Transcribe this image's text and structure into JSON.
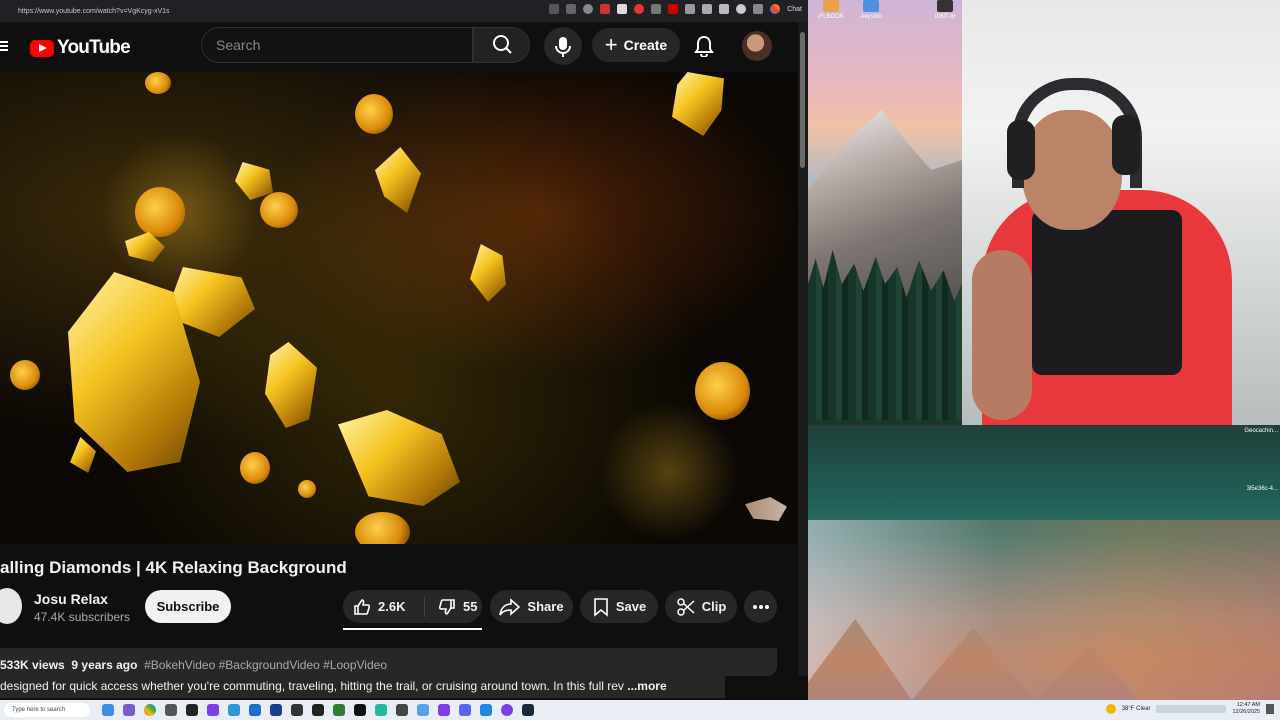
{
  "browser": {
    "url": "https://www.youtube.com/watch?v=VgKcyg-xV1s",
    "chat_label": "Chat"
  },
  "header": {
    "logo_text": "YouTube",
    "search_placeholder": "Search",
    "create_label": "Create"
  },
  "video": {
    "title": "alling Diamonds | 4K Relaxing Background",
    "channel": "Josu Relax",
    "subscribers": "47.4K subscribers",
    "subscribe_label": "Subscribe",
    "likes": "2.6K",
    "dislikes": "55",
    "share_label": "Share",
    "save_label": "Save",
    "clip_label": "Clip",
    "views": "533K views",
    "age": "9 years ago",
    "hashtags": "#BokehVideo #BackgroundVideo #LoopVideo",
    "description": "designed for quick access whether you're commuting, traveling, hitting the trail, or cruising around town. In this full rev",
    "more_label": "...more"
  },
  "desktop": {
    "icon_labels": [
      "iFLBOOK",
      "Aeysion",
      "iDNT-lo"
    ],
    "overlay_label": "Geocachin...",
    "overlay_label2": "3l5e36c-4..."
  },
  "taskbar": {
    "search_placeholder": "Type here to search",
    "weather": "38°F Clear",
    "time": "12:47 AM",
    "date": "12/26/2025"
  }
}
